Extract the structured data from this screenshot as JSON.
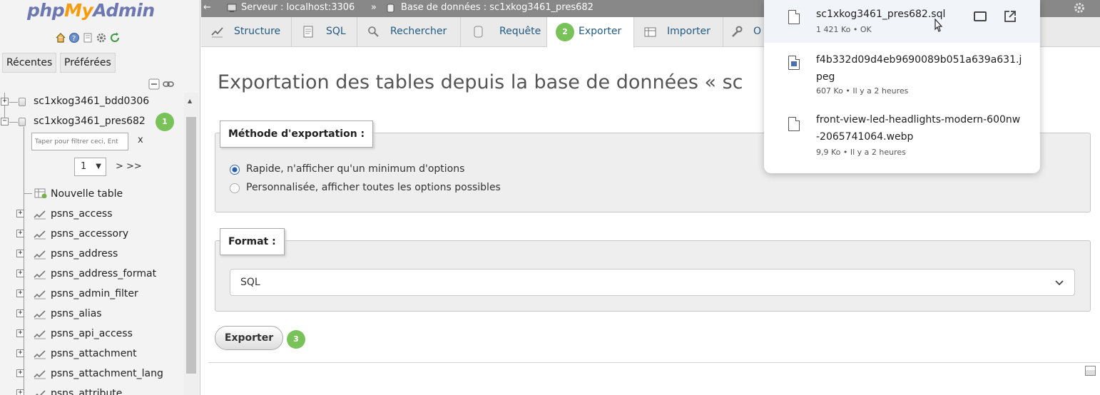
{
  "sidebar": {
    "logo": {
      "php": "php",
      "my": "My",
      "admin": "Admin"
    },
    "nav": {
      "recent": "Récentes",
      "favorites": "Préférées"
    },
    "databases": [
      {
        "name": "sc1xkog3461_bdd0306"
      },
      {
        "name": "sc1xkog3461_pres682",
        "step_badge": "1"
      }
    ],
    "filter": {
      "placeholder": "Taper pour filtrer ceci, Ent",
      "clear": "x"
    },
    "pagination": {
      "page": "1",
      "next": "> >>"
    },
    "new_table": "Nouvelle table",
    "tables": [
      "psns_access",
      "psns_accessory",
      "psns_address",
      "psns_address_format",
      "psns_admin_filter",
      "psns_alias",
      "psns_api_access",
      "psns_attachment",
      "psns_attachment_lang",
      "psns_attribute"
    ]
  },
  "breadcrumb": {
    "back": "←",
    "server": "Serveur : localhost:3306",
    "separator": "»",
    "database": "Base de données : sc1xkog3461_pres682"
  },
  "tabs": [
    {
      "label": "Structure",
      "icon": "structure-icon"
    },
    {
      "label": "SQL",
      "icon": "sql-icon"
    },
    {
      "label": "Rechercher",
      "icon": "search-icon"
    },
    {
      "label": "Requête",
      "icon": "query-icon"
    },
    {
      "label": "Exporter",
      "icon": "export-icon",
      "active": true,
      "step_badge": "2"
    },
    {
      "label": "Importer",
      "icon": "import-icon"
    },
    {
      "label": "O",
      "icon": "wrench-icon"
    }
  ],
  "main": {
    "title": "Exportation des tables depuis la base de données « sc",
    "method": {
      "legend": "Méthode d'exportation :",
      "options": [
        {
          "label": "Rapide, n'afficher qu'un minimum d'options",
          "checked": true
        },
        {
          "label": "Personnalisée, afficher toutes les options possibles",
          "checked": false
        }
      ]
    },
    "format": {
      "legend": "Format :",
      "selected": "SQL"
    },
    "export_button": {
      "label": "Exporter",
      "step_badge": "3"
    }
  },
  "downloads": [
    {
      "name": "sc1xkog3461_pres682.sql",
      "meta": "1 421 Ko • OK",
      "icon": "file-icon"
    },
    {
      "name": "f4b332d09d4eb9690089b051a639a631.jpeg",
      "meta": "607 Ko • Il y a 2 heures",
      "icon": "image-file-icon"
    },
    {
      "name": "front-view-led-headlights-modern-600nw-2065741064.webp",
      "meta": "9,9 Ko • Il y a 2 heures",
      "icon": "file-icon"
    }
  ],
  "colors": {
    "badge": "#79c25a",
    "topbar": "#888888",
    "tab_text": "#235a81",
    "logo_blue": "#6c78af",
    "logo_orange": "#f89c0e"
  }
}
